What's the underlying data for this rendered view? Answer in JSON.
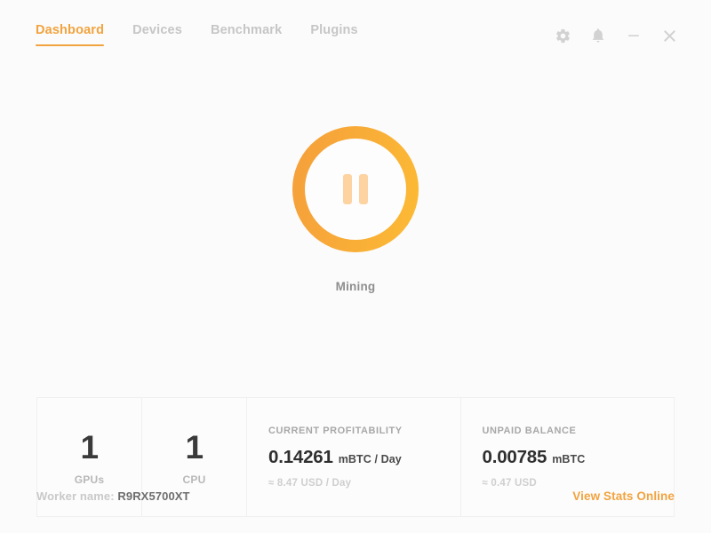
{
  "window": {
    "controls": [
      {
        "name": "settings-button",
        "icon": "gear-icon",
        "label": "Settings"
      },
      {
        "name": "notifications-button",
        "icon": "bell-icon",
        "label": "Notifications"
      },
      {
        "name": "minimize-button",
        "icon": "minimize-icon",
        "label": "Minimize"
      },
      {
        "name": "close-button",
        "icon": "close-icon",
        "label": "Close"
      }
    ]
  },
  "nav": {
    "tabs": [
      {
        "label": "Dashboard",
        "active": true
      },
      {
        "label": "Devices",
        "active": false
      },
      {
        "label": "Benchmark",
        "active": false
      },
      {
        "label": "Plugins",
        "active": false
      }
    ]
  },
  "hero": {
    "button_icon": "pause-icon",
    "button_state": "mining",
    "status": "Mining",
    "ring_color_start": "#f59f3c",
    "ring_color_end": "#fcbb34",
    "pause_bar_color": "#fdd3a2"
  },
  "stats": {
    "gpus": {
      "value": "1",
      "label": "GPUs"
    },
    "cpu": {
      "value": "1",
      "label": "CPU"
    },
    "profitability": {
      "title": "CURRENT PROFITABILITY",
      "value": "0.14261",
      "unit": "mBTC / Day",
      "sub": "≈ 8.47 USD / Day"
    },
    "balance": {
      "title": "UNPAID BALANCE",
      "value": "0.00785",
      "unit": "mBTC",
      "sub": "≈ 0.47 USD"
    }
  },
  "footer": {
    "worker_label": "Worker name:",
    "worker_name": "R9RX5700XT",
    "stats_link": "View Stats Online"
  },
  "theme": {
    "accent": "#f2a33e",
    "background": "#fbfbfb",
    "card_background": "#fcfcfc",
    "card_border": "#f0f0f0"
  }
}
